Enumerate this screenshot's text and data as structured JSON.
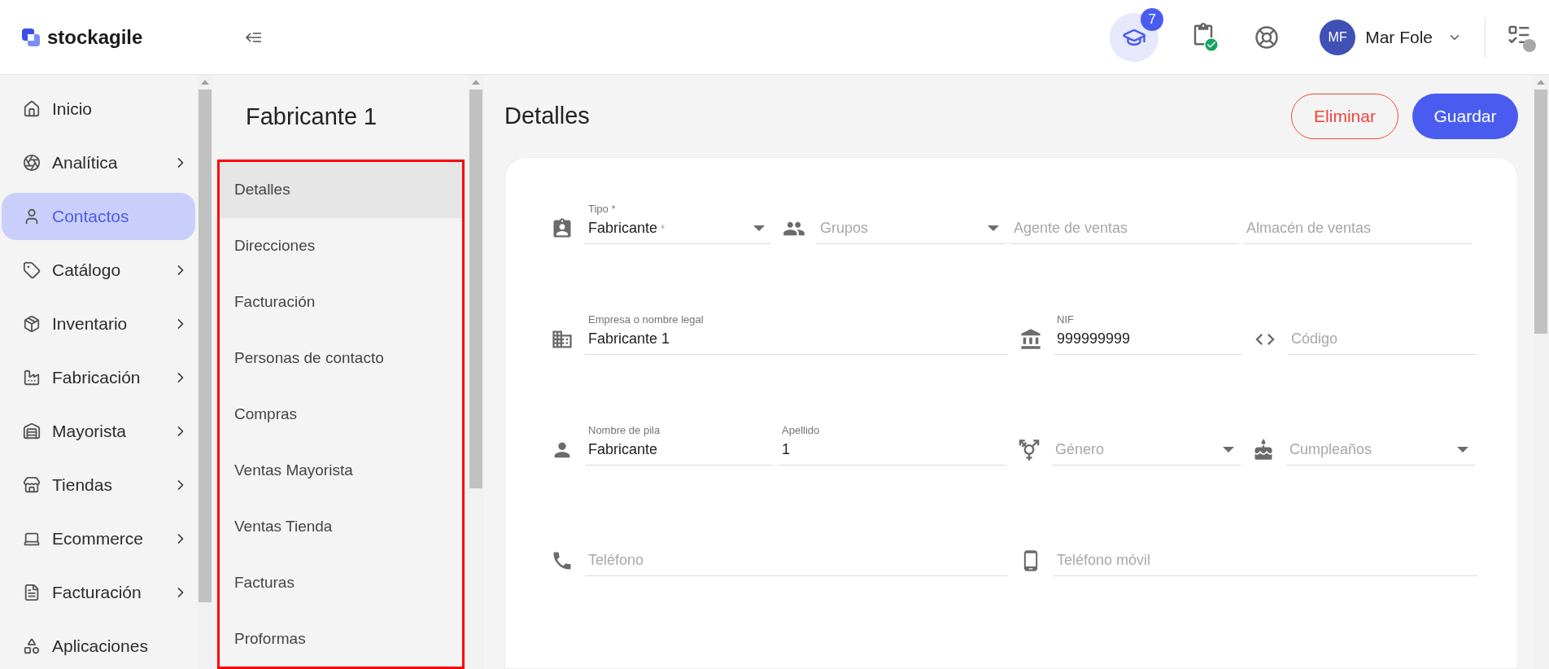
{
  "header": {
    "logo": "stockagile",
    "badge": "7",
    "user": {
      "initials": "MF",
      "name": "Mar Fole"
    }
  },
  "nav": [
    {
      "label": "Inicio",
      "submenu": false,
      "selected": false
    },
    {
      "label": "Analítica",
      "submenu": true,
      "selected": false
    },
    {
      "label": "Contactos",
      "submenu": false,
      "selected": true
    },
    {
      "label": "Catálogo",
      "submenu": true,
      "selected": false
    },
    {
      "label": "Inventario",
      "submenu": true,
      "selected": false
    },
    {
      "label": "Fabricación",
      "submenu": true,
      "selected": false
    },
    {
      "label": "Mayorista",
      "submenu": true,
      "selected": false
    },
    {
      "label": "Tiendas",
      "submenu": true,
      "selected": false
    },
    {
      "label": "Ecommerce",
      "submenu": true,
      "selected": false
    },
    {
      "label": "Facturación",
      "submenu": true,
      "selected": false
    },
    {
      "label": "Aplicaciones",
      "submenu": false,
      "selected": false
    }
  ],
  "record": {
    "title": "Fabricante 1",
    "sections": [
      {
        "label": "Detalles",
        "selected": true
      },
      {
        "label": "Direcciones",
        "selected": false
      },
      {
        "label": "Facturación",
        "selected": false
      },
      {
        "label": "Personas de contacto",
        "selected": false
      },
      {
        "label": "Compras",
        "selected": false
      },
      {
        "label": "Ventas Mayorista",
        "selected": false
      },
      {
        "label": "Ventas Tienda",
        "selected": false
      },
      {
        "label": "Facturas",
        "selected": false
      },
      {
        "label": "Proformas",
        "selected": false
      }
    ]
  },
  "page": {
    "title": "Detalles",
    "actions": [
      {
        "label": "Eliminar",
        "kind": "danger"
      },
      {
        "label": "Guardar",
        "kind": "primary"
      }
    ]
  },
  "form": {
    "rows": [
      {
        "fields": [
          {
            "kind": "select",
            "label": "Tipo *",
            "value": "Fabricante",
            "value_mark": "*"
          },
          {
            "kind": "select",
            "placeholder": "Grupos"
          },
          {
            "kind": "text",
            "placeholder": "Agente de ventas"
          },
          {
            "kind": "text",
            "placeholder": "Almacén de ventas"
          }
        ]
      },
      {
        "fields": [
          {
            "kind": "text",
            "label": "Empresa o nombre legal",
            "value": "Fabricante 1"
          },
          {
            "kind": "text",
            "label": "NIF",
            "value": "999999999"
          },
          {
            "kind": "text",
            "placeholder": "Código"
          }
        ]
      },
      {
        "fields": [
          {
            "kind": "text",
            "label": "Nombre de pila",
            "value": "Fabricante"
          },
          {
            "kind": "text",
            "label": "Apellido",
            "value": "1"
          },
          {
            "kind": "select",
            "placeholder": "Género"
          },
          {
            "kind": "select",
            "placeholder": "Cumpleaños"
          }
        ]
      },
      {
        "fields": [
          {
            "kind": "text",
            "placeholder": "Teléfono"
          },
          {
            "kind": "text",
            "placeholder": "Teléfono móvil"
          }
        ]
      }
    ]
  }
}
